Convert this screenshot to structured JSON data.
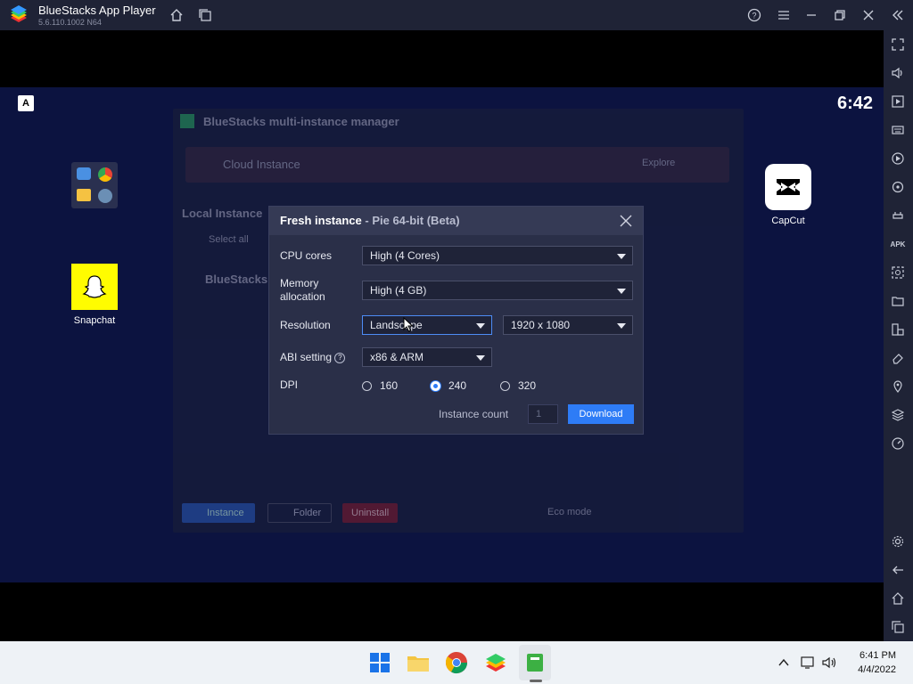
{
  "window": {
    "title": "BlueStacks App Player",
    "version": "5.6.110.1002 N64"
  },
  "android": {
    "clock": "6:42",
    "badge": "A",
    "apps": [
      {
        "name": "Snapchat"
      },
      {
        "name": "CapCut"
      }
    ]
  },
  "manager": {
    "title": "BlueStacks multi-instance manager",
    "cloud_label": "Cloud Instance",
    "explore_label": "Explore",
    "local_heading": "Local Instance",
    "select_all": "Select all",
    "row_name": "BlueStacks",
    "btn_instance": "Instance",
    "btn_folder": "Folder",
    "btn_farm": "Eco mode",
    "btn_uninstall": "Uninstall"
  },
  "dialog": {
    "title": "Fresh instance",
    "subtitle": " - Pie 64-bit (Beta)",
    "cpu_label": "CPU cores",
    "cpu_value": "High (4 Cores)",
    "memory_label_1": "Memory",
    "memory_label_2": "allocation",
    "memory_value": "High (4 GB)",
    "resolution_label": "Resolution",
    "orientation_value": "Landscape",
    "resolution_value": "1920 x 1080",
    "abi_label": "ABI setting",
    "abi_value": "x86 & ARM",
    "dpi_label": "DPI",
    "dpi_options": [
      "160",
      "240",
      "320"
    ],
    "dpi_selected": "240",
    "instance_count_label": "Instance count",
    "instance_count_value": "1",
    "download_label": "Download"
  },
  "taskbar": {
    "time": "6:41 PM",
    "date": "4/4/2022"
  },
  "colors": {
    "accent": "#2e7cf6",
    "titlebar": "#1f2336",
    "screen_bg": "#0c1340",
    "dialog_bg": "#2a2f48"
  }
}
